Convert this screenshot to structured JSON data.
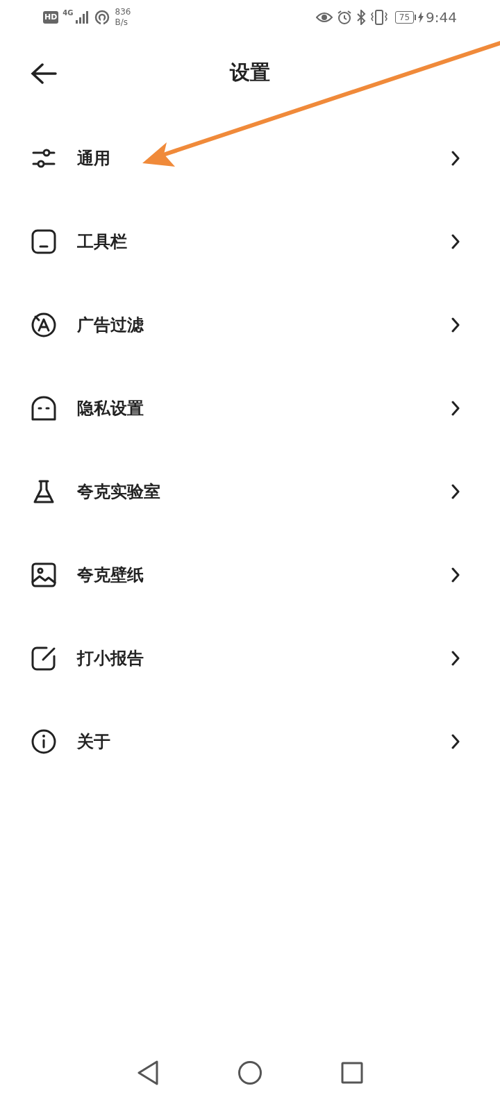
{
  "status_bar": {
    "hd": "HD",
    "network": "4G",
    "speed": "836",
    "speed_unit": "B/s",
    "battery": "75",
    "time": "9:44"
  },
  "header": {
    "title": "设置"
  },
  "items": [
    {
      "label": "通用"
    },
    {
      "label": "工具栏"
    },
    {
      "label": "广告过滤"
    },
    {
      "label": "隐私设置"
    },
    {
      "label": "夸克实验室"
    },
    {
      "label": "夸克壁纸"
    },
    {
      "label": "打小报告"
    },
    {
      "label": "关于"
    }
  ]
}
